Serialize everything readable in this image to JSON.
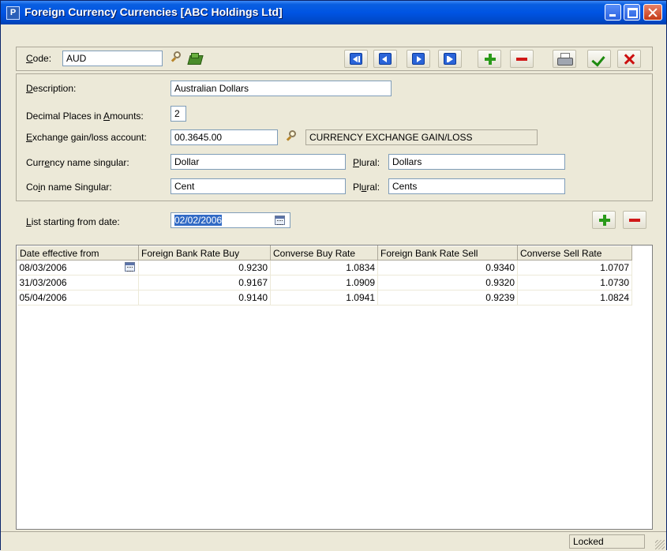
{
  "window": {
    "title": "Foreign Currency Currencies [ABC Holdings Ltd]",
    "app_icon_glyph": "P"
  },
  "header": {
    "code_label_u": "C",
    "code_label_rest": "ode:",
    "code_value": "AUD"
  },
  "form": {
    "description_label_u": "D",
    "description_label_rest": "escription:",
    "description_value": "Australian Dollars",
    "decimal_label_pre": "Decimal Places in ",
    "decimal_label_u": "A",
    "decimal_label_post": "mounts:",
    "decimal_value": "2",
    "exchange_label_u": "E",
    "exchange_label_rest": "xchange gain/loss account:",
    "exchange_value": "00.3645.00",
    "exchange_desc": "CURRENCY EXCHANGE GAIN/LOSS",
    "currency_singular_label_pre": "Curr",
    "currency_singular_label_u": "e",
    "currency_singular_label_post": "ncy name singular:",
    "currency_singular_value": "Dollar",
    "currency_plural_label_u": "P",
    "currency_plural_label_rest": "lural:",
    "currency_plural_value": "Dollars",
    "coin_singular_label_pre": "Co",
    "coin_singular_label_u": "i",
    "coin_singular_label_post": "n name Singular:",
    "coin_singular_value": "Cent",
    "coin_plural_label_pre": "Pl",
    "coin_plural_label_u": "u",
    "coin_plural_label_post": "ral:",
    "coin_plural_value": "Cents"
  },
  "list": {
    "start_label_u": "L",
    "start_label_rest": "ist starting from date:",
    "start_value": "02/02/2006"
  },
  "grid": {
    "columns": [
      "Date effective from",
      "Foreign Bank Rate Buy",
      "Converse Buy Rate",
      "Foreign Bank Rate Sell",
      "Converse Sell Rate"
    ],
    "rows": [
      [
        "08/03/2006",
        "0.9230",
        "1.0834",
        "0.9340",
        "1.0707"
      ],
      [
        "31/03/2006",
        "0.9167",
        "1.0909",
        "0.9320",
        "1.0730"
      ],
      [
        "05/04/2006",
        "0.9140",
        "1.0941",
        "0.9239",
        "1.0824"
      ]
    ]
  },
  "status": {
    "state": "Locked"
  },
  "colors": {
    "titlebar": "#0054e3",
    "nav_blue": "#2a64d8",
    "add_green": "#2a9a1a",
    "delete_red": "#d01818",
    "selection": "#316ac5"
  },
  "icons": [
    "magnifier-icon",
    "folder-icon",
    "first-record-icon",
    "previous-record-icon",
    "next-record-icon",
    "last-record-icon",
    "plus-icon",
    "minus-icon",
    "printer-icon",
    "check-icon",
    "cross-icon",
    "calendar-icon"
  ]
}
